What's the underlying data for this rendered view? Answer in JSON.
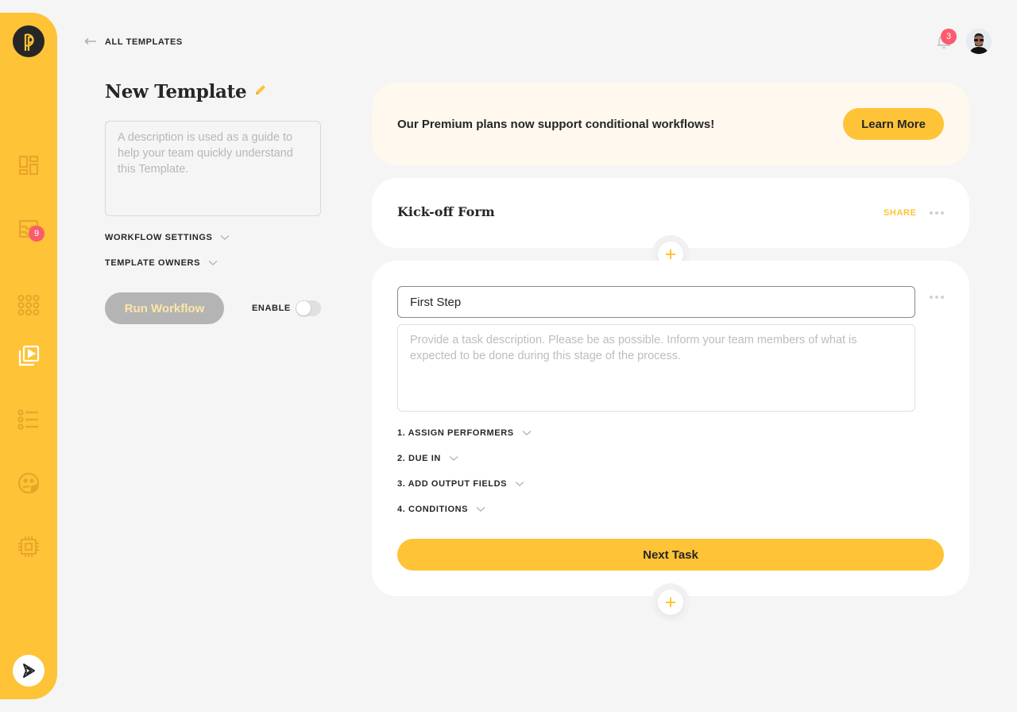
{
  "sidebar": {
    "logo": "pneumatic-logo-icon",
    "items": [
      {
        "name": "dashboard",
        "icon": "dashboard-icon",
        "active": false
      },
      {
        "name": "tasks",
        "icon": "inbox-icon",
        "active": false,
        "badge": "9"
      },
      {
        "name": "workflows",
        "icon": "workflows-icon",
        "active": false
      },
      {
        "name": "templates",
        "icon": "templates-play-icon",
        "active": true
      },
      {
        "name": "highlights",
        "icon": "list-icon",
        "active": false
      },
      {
        "name": "team",
        "icon": "face-icon",
        "active": false
      },
      {
        "name": "integrations",
        "icon": "chip-icon",
        "active": false
      }
    ],
    "bottom_icon": "play-logo-icon"
  },
  "header": {
    "back_label": "ALL TEMPLATES",
    "notifications_count": "3"
  },
  "template": {
    "title": "New Template",
    "description_placeholder": "A description is used as a guide to help your team quickly understand this Template.",
    "workflow_settings_label": "WORKFLOW SETTINGS",
    "template_owners_label": "TEMPLATE OWNERS",
    "run_label": "Run Workflow",
    "enable_label": "ENABLE",
    "enabled": false
  },
  "promo": {
    "text": "Our Premium plans now support conditional workflows!",
    "button_label": "Learn More"
  },
  "kickoff": {
    "title": "Kick-off Form",
    "share_label": "SHARE"
  },
  "task": {
    "name_value": "First Step",
    "description_placeholder": "Provide a task description. Please be as possible. Inform your team members of what is expected to be done during this stage of the process.",
    "sections": [
      "1. ASSIGN PERFORMERS",
      "2. DUE IN",
      "3. ADD OUTPUT FIELDS",
      "4. CONDITIONS"
    ],
    "next_label": "Next Task"
  },
  "colors": {
    "accent": "#fec336",
    "badge": "#fb5b6e",
    "text": "#262626",
    "background": "#f5f5f5",
    "promo_bg": "#fff8ee"
  }
}
